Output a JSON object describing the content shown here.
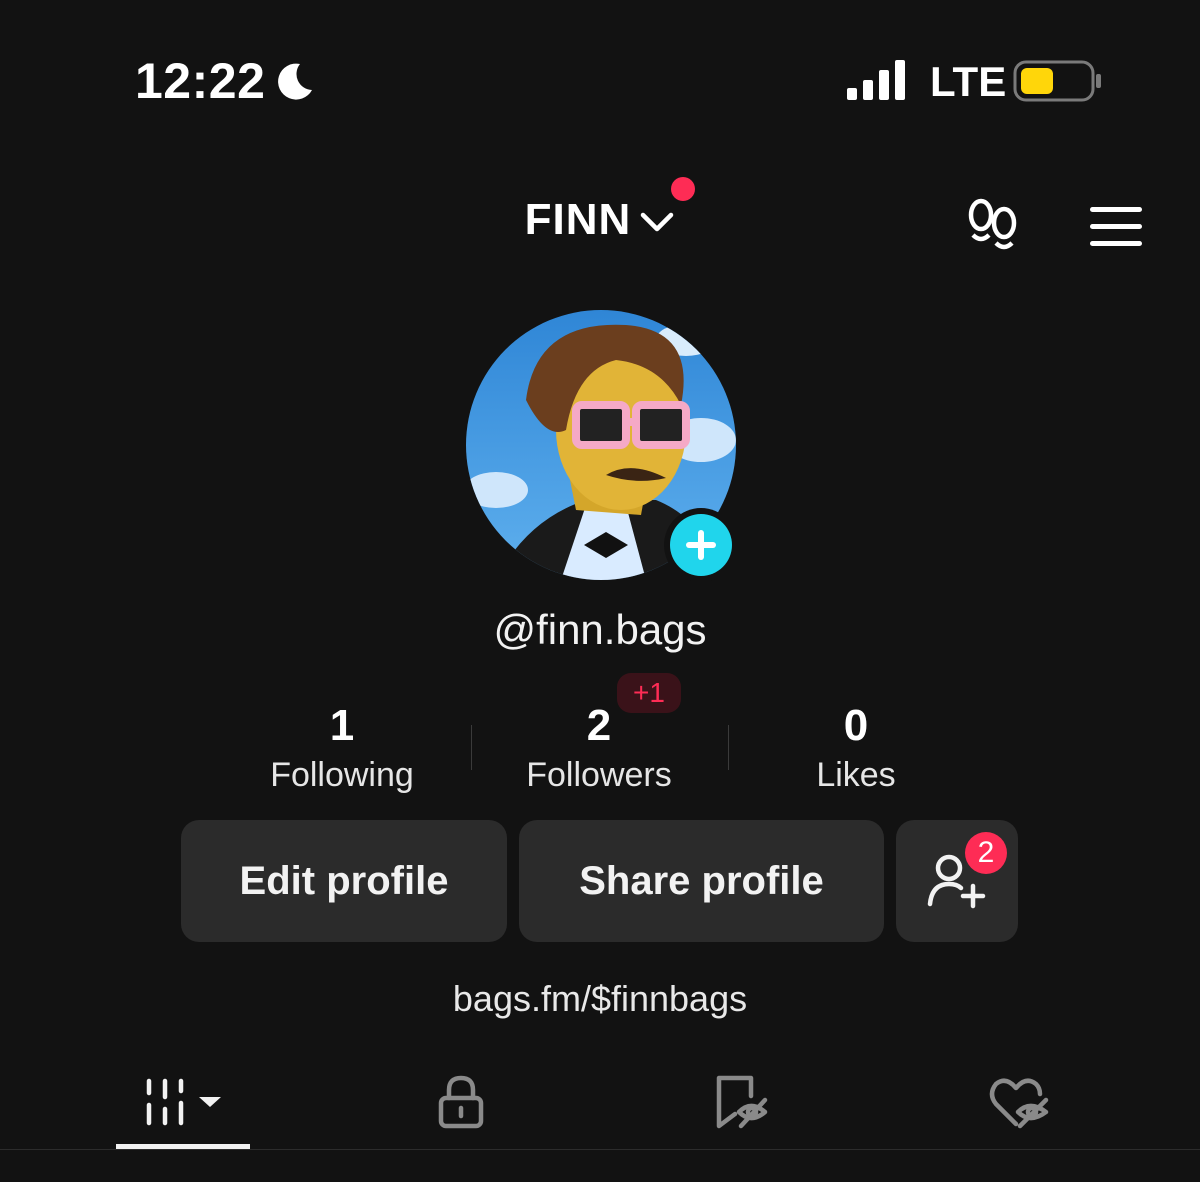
{
  "status_bar": {
    "time": "12:22",
    "network": "LTE",
    "icons": [
      "moon-icon",
      "signal-icon",
      "battery-icon"
    ],
    "battery_color": "#ffd60a"
  },
  "header": {
    "username": "FINN",
    "icons": [
      "chevron-down-icon",
      "footprint-icon",
      "menu-icon"
    ],
    "notification_dot_color": "#fe2c55"
  },
  "profile": {
    "handle": "@finn.bags",
    "add_icon": "plus-icon",
    "accent_color": "#20d5ec"
  },
  "stats": {
    "following": {
      "value": "1",
      "label": "Following"
    },
    "followers": {
      "value": "2",
      "label": "Followers",
      "delta": "+1"
    },
    "likes": {
      "value": "0",
      "label": "Likes"
    }
  },
  "actions": {
    "edit_label": "Edit profile",
    "share_label": "Share profile",
    "add_friends_badge": "2",
    "add_friends_icon": "add-person-icon"
  },
  "bio": {
    "link": "bags.fm/$finnbags"
  },
  "tabs": [
    {
      "icon": "grid-icon",
      "active": true
    },
    {
      "icon": "lock-icon",
      "active": false
    },
    {
      "icon": "bookmark-hidden-icon",
      "active": false
    },
    {
      "icon": "heart-hidden-icon",
      "active": false
    }
  ]
}
